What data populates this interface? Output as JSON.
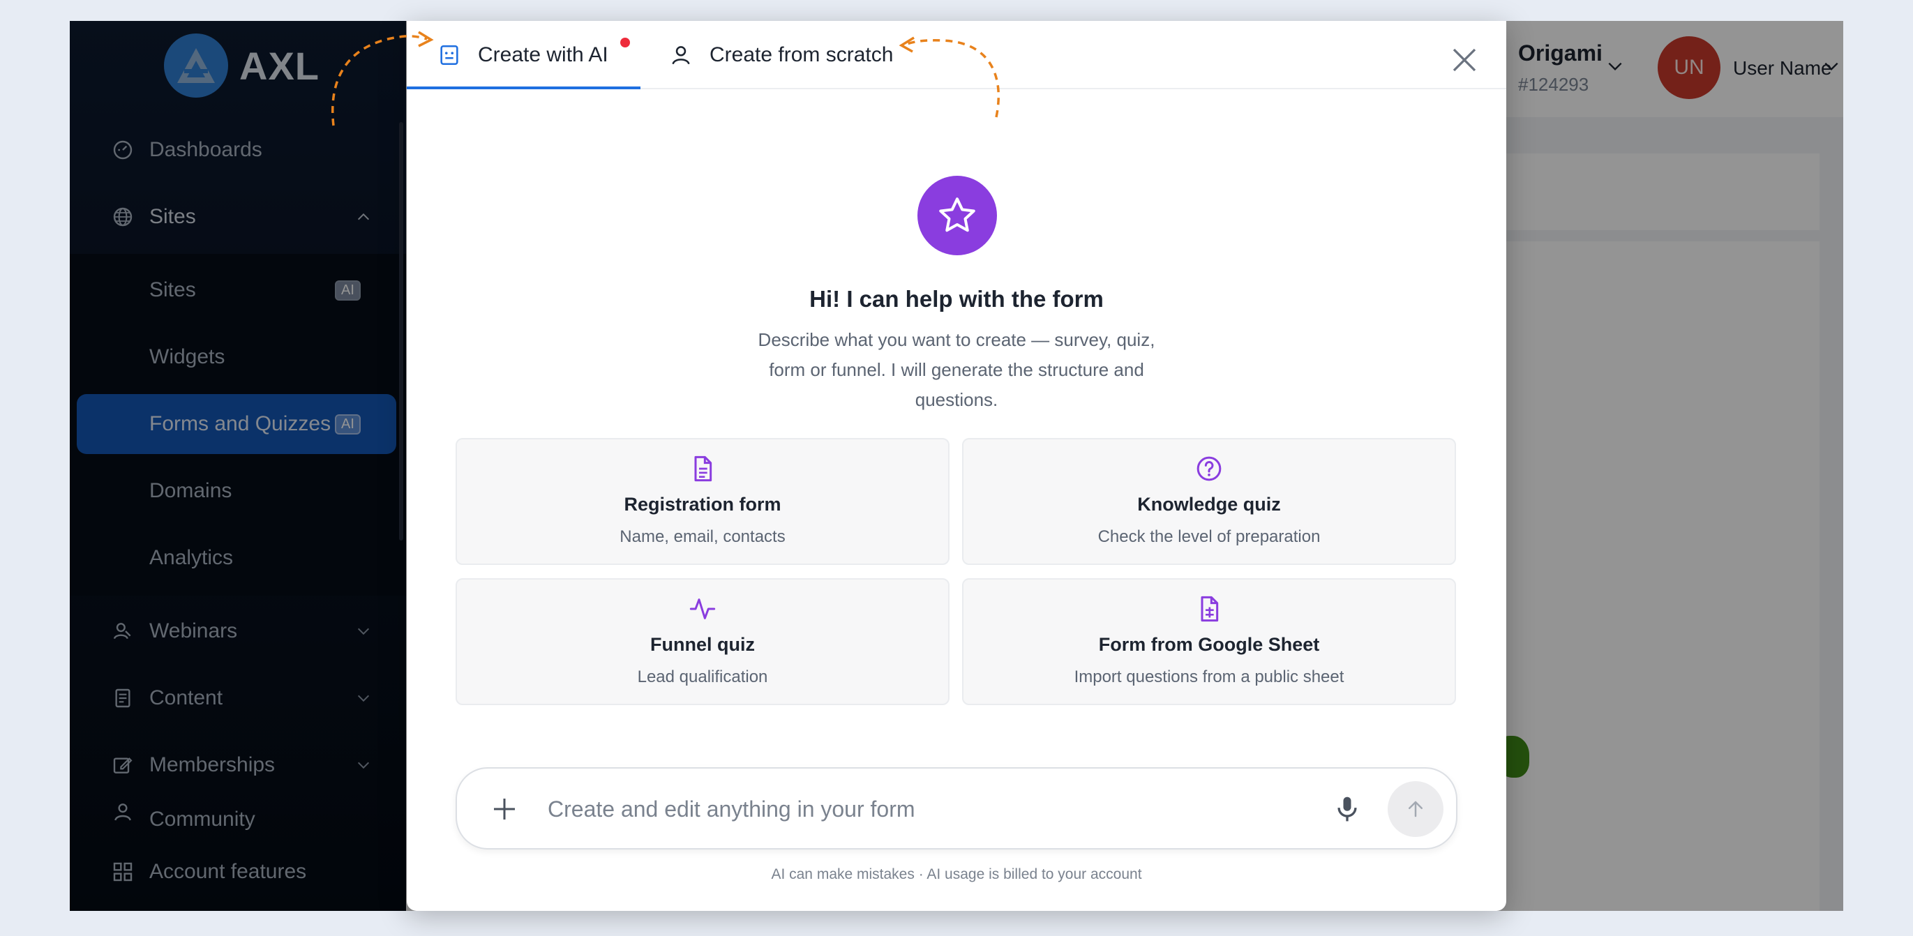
{
  "brand": {
    "name": "AXL",
    "color": "#2f7fd3"
  },
  "sidebar": {
    "items": [
      {
        "label": "Dashboards",
        "icon": "dashboard-gauge-icon"
      },
      {
        "label": "Sites",
        "icon": "globe-icon",
        "expanded": true
      },
      {
        "label": "Sites",
        "badge": "AI"
      },
      {
        "label": "Widgets"
      },
      {
        "label": "Forms and Quizzes",
        "badge": "AI",
        "active": true
      },
      {
        "label": "Domains"
      },
      {
        "label": "Analytics"
      },
      {
        "label": "Webinars",
        "icon": "webinar-user-icon"
      },
      {
        "label": "Content",
        "icon": "content-book-icon"
      },
      {
        "label": "Memberships",
        "icon": "edit-square-icon"
      },
      {
        "label": "Community",
        "icon": "person-icon"
      },
      {
        "label": "Account features",
        "icon": "grid-icon"
      }
    ]
  },
  "topbar": {
    "org_name": "Origami",
    "org_id": "#124293",
    "avatar_initials": "UN",
    "avatar_color": "#c9392c",
    "user_name": "User Name"
  },
  "modal": {
    "tabs": [
      {
        "label": "Create with AI",
        "active": true,
        "notification_dot": true
      },
      {
        "label": "Create from scratch",
        "active": false
      }
    ],
    "hero": {
      "icon": "star-icon",
      "title": "Hi! I can help with the form",
      "description": "Describe what you want to create — survey, quiz, form or funnel. I will generate the structure and questions."
    },
    "suggestions": [
      {
        "title": "Registration form",
        "description": "Name, email, contacts",
        "icon": "document-icon"
      },
      {
        "title": "Knowledge quiz",
        "description": "Check the level of preparation",
        "icon": "question-circle-icon"
      },
      {
        "title": "Funnel quiz",
        "description": "Lead qualification",
        "icon": "activity-pulse-icon"
      },
      {
        "title": "Form from Google Sheet",
        "description": "Import questions from a public sheet",
        "icon": "sheet-document-icon"
      }
    ],
    "composer": {
      "placeholder": "Create and edit anything in your form",
      "value": ""
    },
    "disclaimer": "AI can make mistakes · AI usage is billed to your account"
  },
  "colors": {
    "accent_purple": "#8a3ddf",
    "tab_underline": "#1f6fe0",
    "active_nav": "#1457b5",
    "annotation_arrow": "#e8821c",
    "notification_dot": "#ee2b3b"
  }
}
